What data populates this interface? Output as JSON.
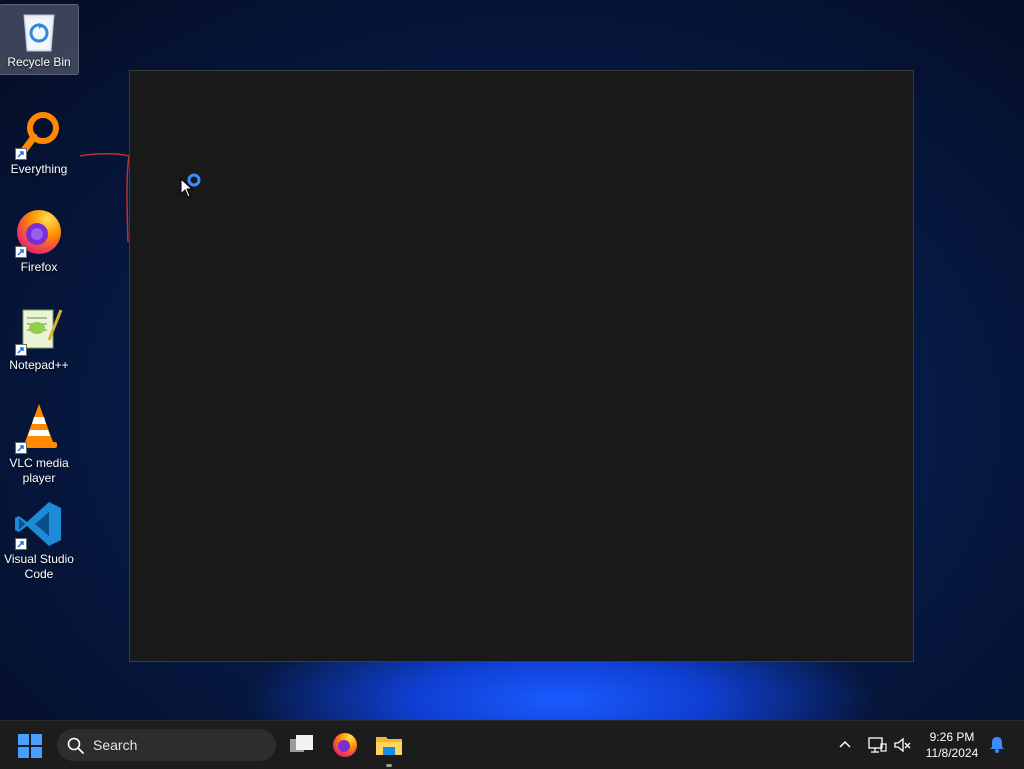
{
  "desktop": {
    "icons": [
      {
        "label": "Recycle Bin",
        "icon": "recycle-bin-icon"
      },
      {
        "label": "Everything",
        "icon": "everything-search-icon"
      },
      {
        "label": "Firefox",
        "icon": "firefox-icon"
      },
      {
        "label": "Notepad++",
        "icon": "notepad-plus-plus-icon"
      },
      {
        "label": "VLC media player",
        "icon": "vlc-icon"
      },
      {
        "label": "Visual Studio Code",
        "icon": "vscode-icon"
      }
    ]
  },
  "taskbar": {
    "search_placeholder": "Search",
    "pinned_apps": [
      "task-view-icon",
      "firefox-icon",
      "file-explorer-icon"
    ],
    "tray_icons": [
      "chevron-up-icon",
      "network-icon",
      "volume-muted-icon",
      "notification-bell-icon"
    ],
    "clock": {
      "time": "9:26 PM",
      "date": "11/8/2024"
    }
  },
  "colors": {
    "accent": "#47a0ff",
    "window_bg": "#191919",
    "taskbar_bg": "#1c1c1c"
  }
}
